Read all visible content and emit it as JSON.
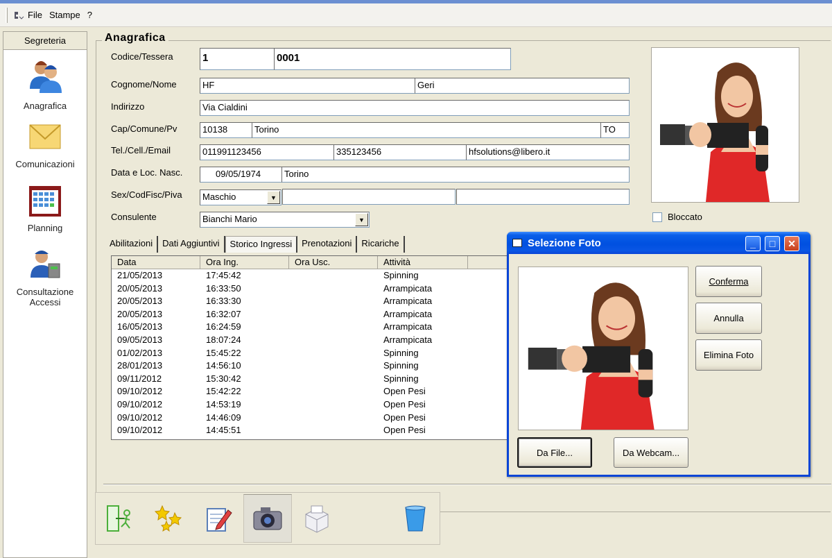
{
  "menu": {
    "items": [
      "File",
      "Stampe",
      "?"
    ]
  },
  "sidebar": {
    "header": "Segreteria",
    "items": [
      {
        "label": "Anagrafica"
      },
      {
        "label": "Comunicazioni"
      },
      {
        "label": "Planning"
      },
      {
        "label": "Consultazione Accessi"
      }
    ]
  },
  "form": {
    "title": "Anagrafica",
    "labels": {
      "codice": "Codice/Tessera",
      "cognome": "Cognome/Nome",
      "indirizzo": "Indirizzo",
      "cap": "Cap/Comune/Pv",
      "tel": "Tel./Cell./Email",
      "nascita": "Data e Loc. Nasc.",
      "sesso": "Sex/CodFisc/Piva",
      "consulente": "Consulente"
    },
    "values": {
      "codice": "1",
      "tessera": "0001",
      "cognome": "HF",
      "nome": "Geri",
      "indirizzo": "Via Cialdini",
      "cap": "10138",
      "comune": "Torino",
      "pv": "TO",
      "tel": "011991123456",
      "cell": "335123456",
      "email": "hfsolutions@libero.it",
      "data_nascita": "09/05/1974",
      "loc_nascita": "Torino",
      "sesso": "Maschio",
      "codfisc": "",
      "piva": "",
      "consulente": "Bianchi Mario"
    },
    "bloccato_label": "Bloccato",
    "bloccato_checked": false
  },
  "tabs": [
    "Abilitazioni",
    "Dati Aggiuntivi",
    "Storico Ingressi",
    "Prenotazioni",
    "Ricariche"
  ],
  "active_tab": "Storico Ingressi",
  "history": {
    "columns": [
      "Data",
      "Ora Ing.",
      "Ora Usc.",
      "Attività"
    ],
    "rows": [
      [
        "21/05/2013",
        "17:45:42",
        "",
        "Spinning"
      ],
      [
        "20/05/2013",
        "16:33:50",
        "",
        "Arrampicata"
      ],
      [
        "20/05/2013",
        "16:33:30",
        "",
        "Arrampicata"
      ],
      [
        "20/05/2013",
        "16:32:07",
        "",
        "Arrampicata"
      ],
      [
        "16/05/2013",
        "16:24:59",
        "",
        "Arrampicata"
      ],
      [
        "09/05/2013",
        "18:07:24",
        "",
        "Arrampicata"
      ],
      [
        "01/02/2013",
        "15:45:22",
        "",
        "Spinning"
      ],
      [
        "28/01/2013",
        "14:56:10",
        "",
        "Spinning"
      ],
      [
        "09/11/2012",
        "15:30:42",
        "",
        "Spinning"
      ],
      [
        "09/10/2012",
        "15:42:22",
        "",
        "Open Pesi"
      ],
      [
        "09/10/2012",
        "14:53:19",
        "",
        "Open Pesi"
      ],
      [
        "09/10/2012",
        "14:46:09",
        "",
        "Open Pesi"
      ],
      [
        "09/10/2012",
        "14:45:51",
        "",
        "Open Pesi"
      ]
    ]
  },
  "toolbar": {
    "icons": [
      "exit-icon",
      "new-icon",
      "edit-icon",
      "camera-icon",
      "print-icon",
      "delete-icon"
    ]
  },
  "dialog": {
    "title": "Selezione Foto",
    "buttons": {
      "conferma": "Conferma",
      "annulla": "Annulla",
      "elimina": "Elimina Foto",
      "da_file": "Da File...",
      "da_webcam": "Da Webcam..."
    }
  },
  "colors": {
    "window_bg": "#ece9d8",
    "title_blue": "#0050e0",
    "close_red": "#c7401c"
  }
}
